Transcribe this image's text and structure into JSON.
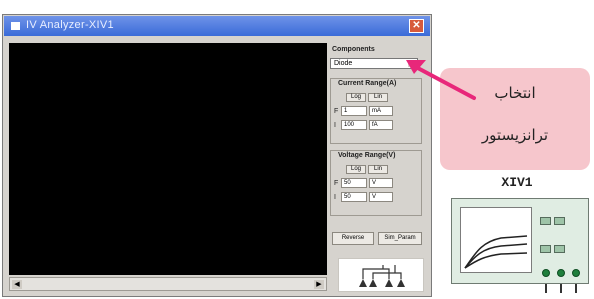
{
  "window": {
    "title": "IV Analyzer-XIV1",
    "close_glyph": "✕"
  },
  "panel": {
    "components_label": "Components",
    "component_selected": "Diode",
    "current_range_label": "Current Range(A)",
    "voltage_range_label": "Voltage Range(V)",
    "log_label": "Log",
    "lin_label": "Lin",
    "f_label": "F",
    "i_label": "I",
    "current_f_value": "1",
    "current_f_unit": "mA",
    "current_i_value": "100",
    "current_i_unit": "fA",
    "voltage_f_value": "50",
    "voltage_f_unit": "V",
    "voltage_i_value": "50",
    "voltage_i_unit": "V",
    "reverse_label": "Reverse",
    "sim_param_label": "Sim_Param"
  },
  "callout": {
    "line1": "انتخاب",
    "line2": "ترانزیستور"
  },
  "instrument": {
    "name": "XIV1"
  },
  "colors": {
    "accent_arrow": "#e8277a",
    "callout_bg": "#f6c6cc"
  }
}
